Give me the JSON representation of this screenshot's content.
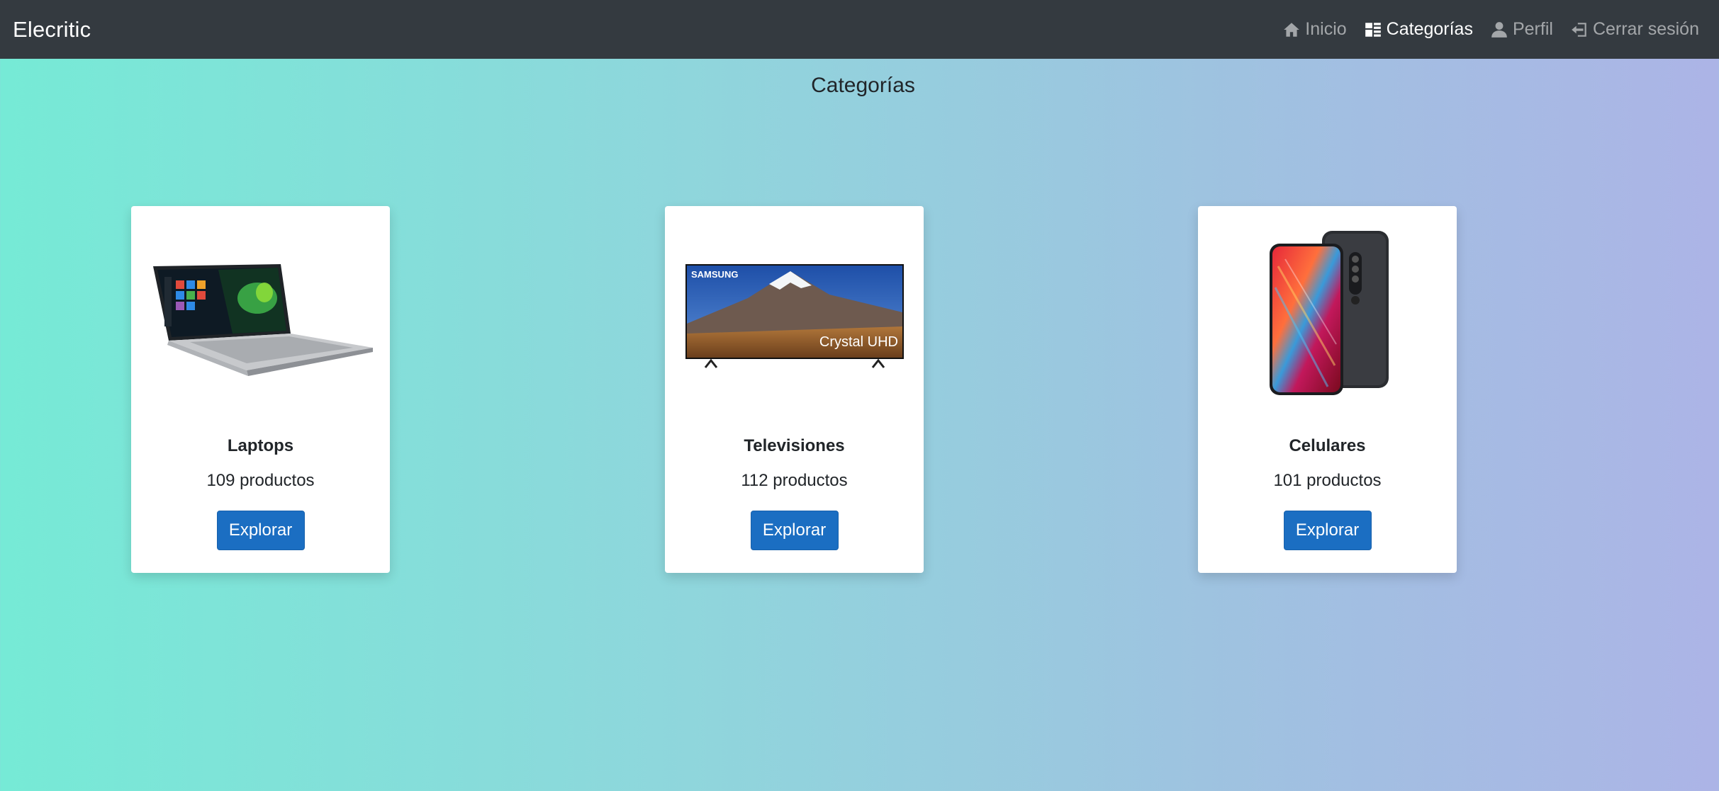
{
  "navbar": {
    "brand": "Elecritic",
    "items": [
      {
        "label": "Inicio",
        "icon": "home-icon",
        "active": false
      },
      {
        "label": "Categorías",
        "icon": "list-icon",
        "active": true
      },
      {
        "label": "Perfil",
        "icon": "person-icon",
        "active": false
      },
      {
        "label": "Cerrar sesión",
        "icon": "logout-icon",
        "active": false
      }
    ]
  },
  "page": {
    "title": "Categorías"
  },
  "categories": [
    {
      "name": "Laptops",
      "count": "109 productos",
      "button": "Explorar",
      "image": "laptop-image"
    },
    {
      "name": "Televisiones",
      "count": "112 productos",
      "button": "Explorar",
      "image": "television-image",
      "tv_brand": "SAMSUNG",
      "tv_caption": "Crystal UHD"
    },
    {
      "name": "Celulares",
      "count": "101 productos",
      "button": "Explorar",
      "image": "phone-image"
    }
  ],
  "colors": {
    "navbar_bg": "#343a40",
    "button_bg": "#1b6ec2",
    "gradient_start": "#76ead6",
    "gradient_end": "#acb4e6"
  }
}
